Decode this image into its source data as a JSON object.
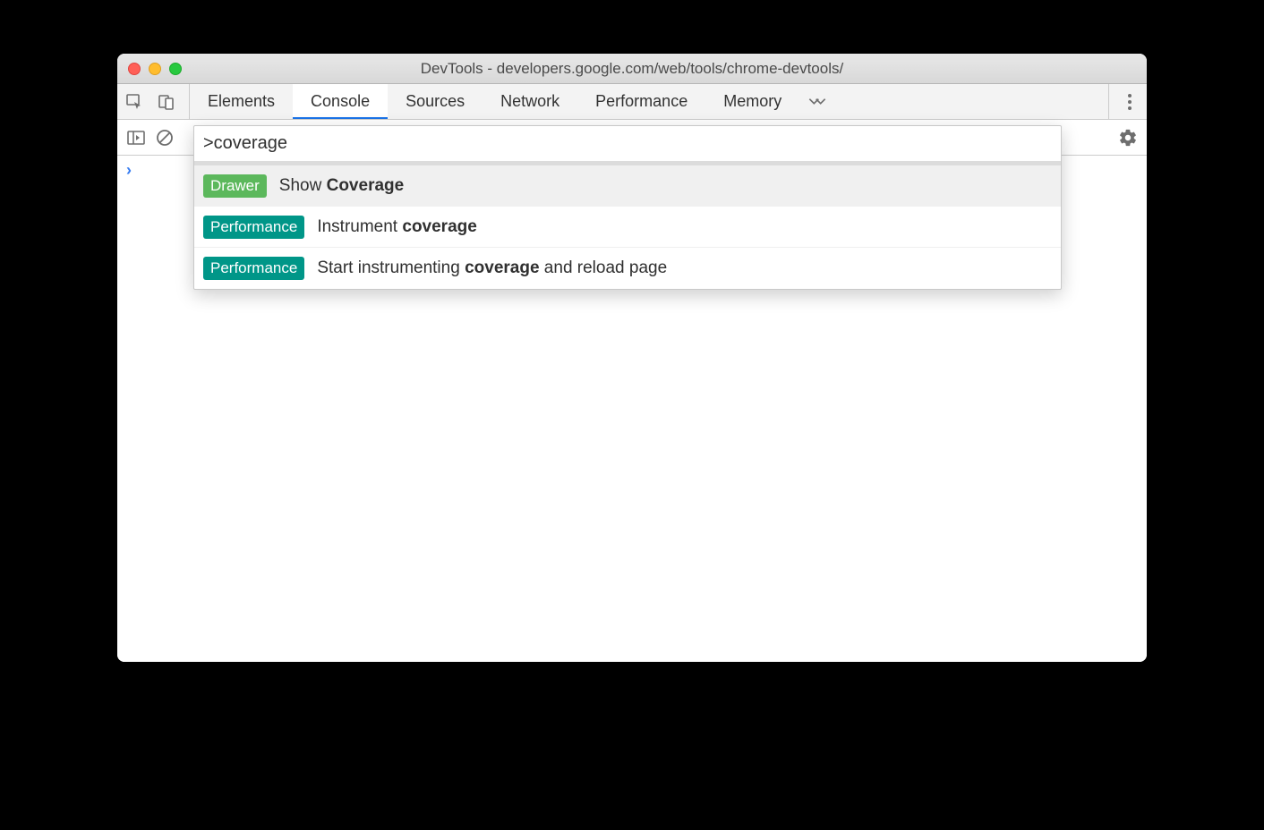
{
  "titlebar": {
    "title": "DevTools - developers.google.com/web/tools/chrome-devtools/"
  },
  "tabs": {
    "items": [
      "Elements",
      "Console",
      "Sources",
      "Network",
      "Performance",
      "Memory"
    ],
    "active": "Console"
  },
  "command_palette": {
    "input_value": ">coverage",
    "items": [
      {
        "badge": "Drawer",
        "badge_class": "badge-drawer",
        "pre": "Show ",
        "match": "Coverage",
        "post": "",
        "selected": true
      },
      {
        "badge": "Performance",
        "badge_class": "badge-perf",
        "pre": "Instrument ",
        "match": "coverage",
        "post": "",
        "selected": false
      },
      {
        "badge": "Performance",
        "badge_class": "badge-perf",
        "pre": "Start instrumenting ",
        "match": "coverage",
        "post": " and reload page",
        "selected": false
      }
    ]
  },
  "console": {
    "prompt_caret": "›"
  }
}
